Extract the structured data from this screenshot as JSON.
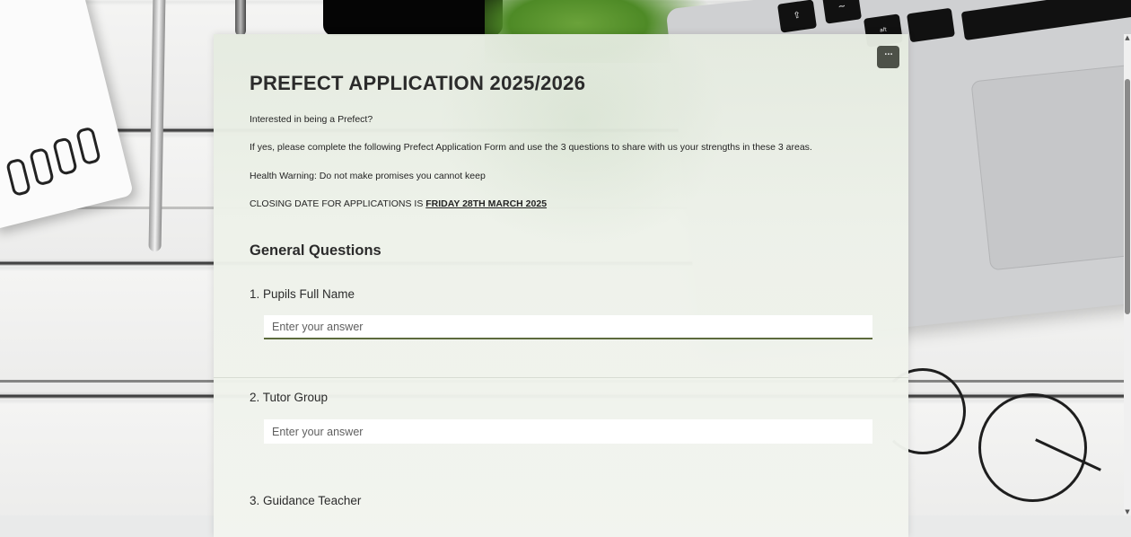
{
  "form": {
    "title": "PREFECT APPLICATION 2025/2026",
    "intro": "Interested in being a Prefect?",
    "instructions": "If yes, please complete the following Prefect Application Form and use the 3 questions to share with us your strengths in these 3 areas.",
    "warning": "Health Warning: Do not make promises you cannot keep",
    "closing_prefix": "CLOSING DATE FOR APPLICATIONS IS ",
    "closing_date": "FRIDAY 28TH MARCH 2025",
    "more_button": "···"
  },
  "section": {
    "title": "General Questions"
  },
  "questions": [
    {
      "label": "1. Pupils Full Name",
      "placeholder": "Enter your answer"
    },
    {
      "label": "2. Tutor Group",
      "placeholder": "Enter your answer"
    },
    {
      "label": "3. Guidance Teacher"
    }
  ],
  "background": {
    "keys": [
      "⇧",
      "~",
      "alt"
    ]
  },
  "colors": {
    "card_background": "#eef2ea",
    "accent": "#5c6b3c",
    "more_button": "#4d5148"
  }
}
